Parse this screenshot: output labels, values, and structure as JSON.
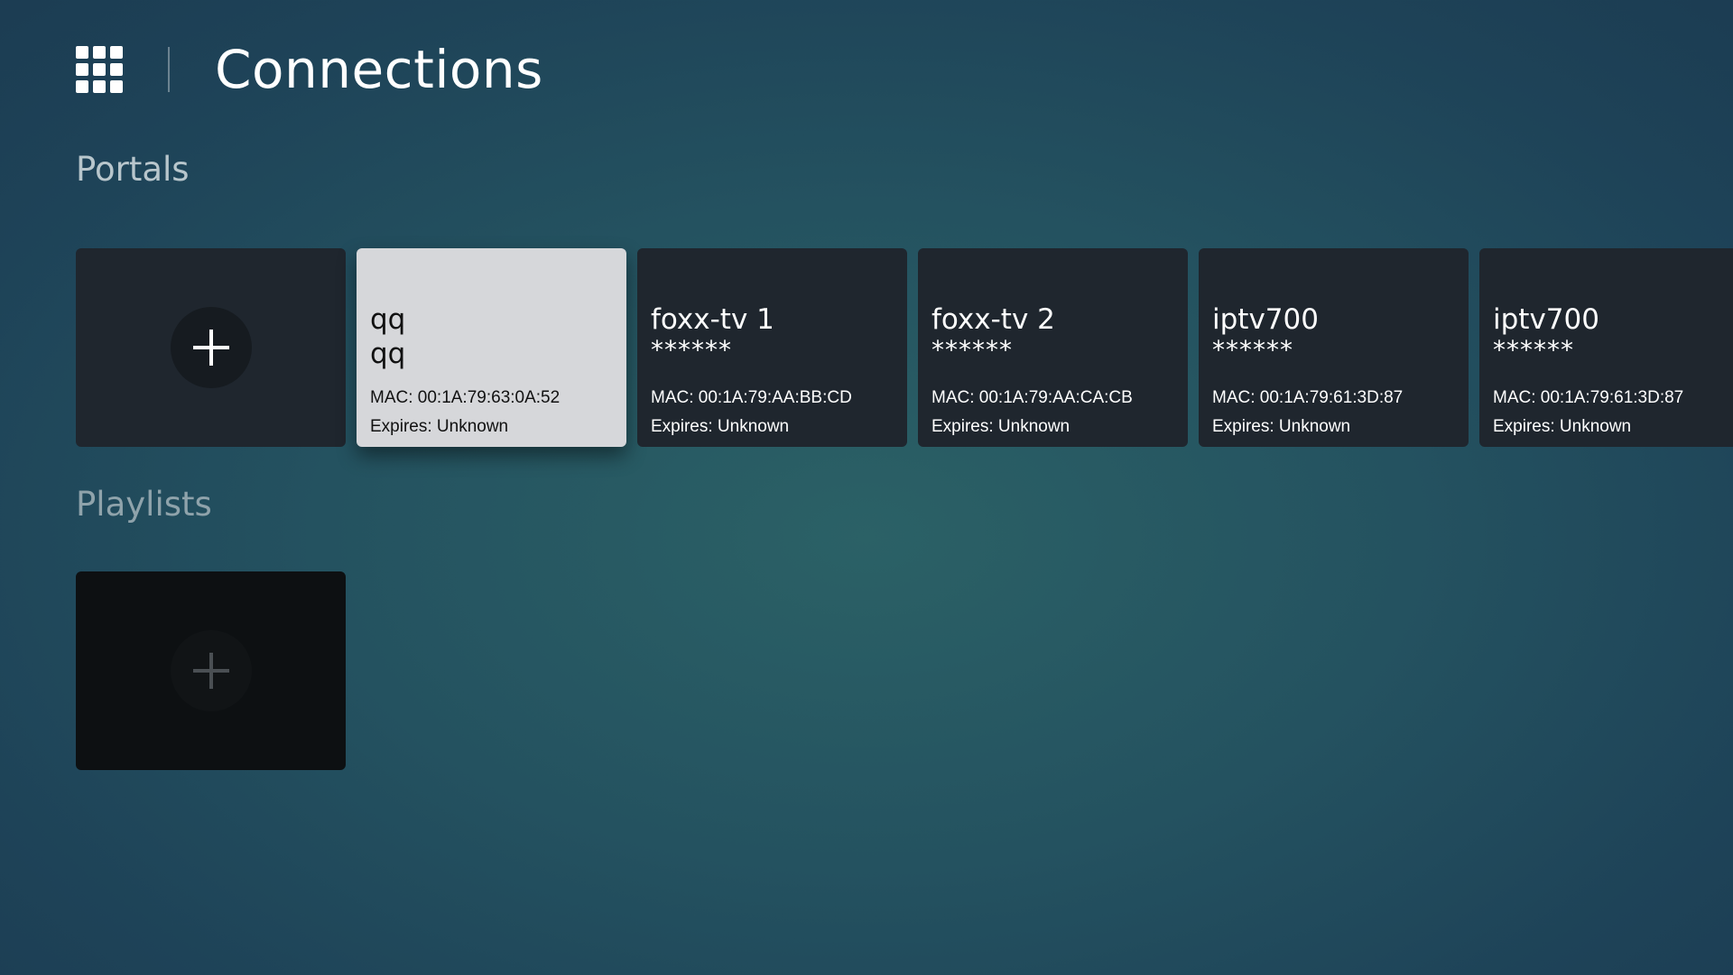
{
  "header": {
    "title": "Connections",
    "apps_icon": "apps-grid-icon"
  },
  "portals": {
    "title": "Portals",
    "add_icon": "plus-icon",
    "items": [
      {
        "name": "qq",
        "sub": "qq",
        "mac": "MAC: 00:1A:79:63:0A:52",
        "expires": "Expires: Unknown",
        "focused": true
      },
      {
        "name": "foxx-tv 1",
        "sub": "******",
        "mac": "MAC: 00:1A:79:AA:BB:CD",
        "expires": "Expires: Unknown"
      },
      {
        "name": "foxx-tv 2",
        "sub": "******",
        "mac": "MAC: 00:1A:79:AA:CA:CB",
        "expires": "Expires: Unknown"
      },
      {
        "name": "iptv700",
        "sub": "******",
        "mac": "MAC: 00:1A:79:61:3D:87",
        "expires": "Expires: Unknown"
      },
      {
        "name": "iptv700",
        "sub": "******",
        "mac": "MAC: 00:1A:79:61:3D:87",
        "expires": "Expires: Unknown"
      }
    ]
  },
  "playlists": {
    "title": "Playlists",
    "add_icon": "plus-icon"
  },
  "colors": {
    "background": "#245260",
    "card": "#1f262e",
    "card_focused": "#d6d7da",
    "playlist_card": "#0d1012"
  }
}
